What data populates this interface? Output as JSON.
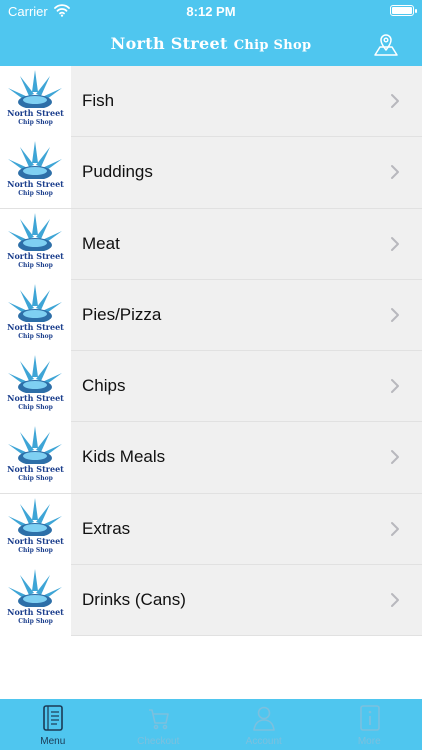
{
  "status_bar": {
    "carrier": "Carrier",
    "time": "8:12 PM"
  },
  "header": {
    "title_main": "North Street",
    "title_sub": "Chip Shop",
    "map_icon": "location-map-icon"
  },
  "thumbnail": {
    "logo_line1": "North Street",
    "logo_line2": "Chip Shop",
    "colors": {
      "sun": "#3ea5d6",
      "fish": "#2d6fa8",
      "text": "#1b3e8c"
    }
  },
  "menu": {
    "items": [
      {
        "label": "Fish"
      },
      {
        "label": "Puddings"
      },
      {
        "label": "Meat"
      },
      {
        "label": "Pies/Pizza"
      },
      {
        "label": "Chips"
      },
      {
        "label": "Kids Meals"
      },
      {
        "label": "Extras"
      },
      {
        "label": "Drinks (Cans)"
      }
    ]
  },
  "tabbar": {
    "tabs": [
      {
        "label": "Menu",
        "icon": "menu-book-icon",
        "active": true
      },
      {
        "label": "Checkout",
        "icon": "cart-icon",
        "active": false
      },
      {
        "label": "Account",
        "icon": "person-icon",
        "active": false
      },
      {
        "label": "More",
        "icon": "info-icon",
        "active": false
      }
    ]
  },
  "colors": {
    "accent": "#4fc6ef",
    "row_bg": "#f0f0f0",
    "active_tab": "#1b3a55",
    "inactive_tab": "#7cc0de"
  }
}
